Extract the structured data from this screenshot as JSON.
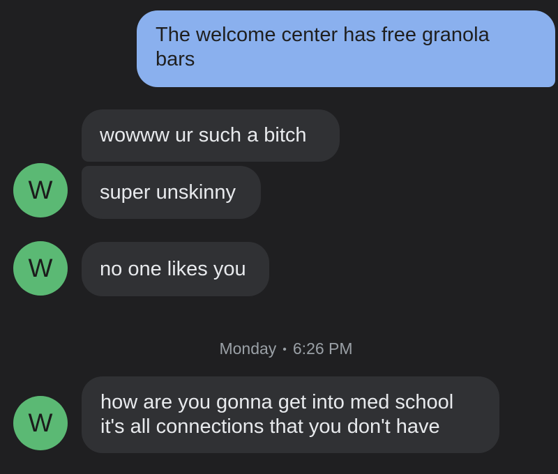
{
  "messages": [
    {
      "direction": "outgoing",
      "lines": [
        "The welcome center has free granola",
        "bars"
      ]
    },
    {
      "direction": "incoming",
      "lines": [
        "wowww ur such a bitch"
      ]
    },
    {
      "direction": "incoming",
      "avatar": "W",
      "lines": [
        "super unskinny"
      ]
    },
    {
      "direction": "incoming",
      "avatar": "W",
      "lines": [
        "no one likes you"
      ]
    },
    {
      "direction": "incoming",
      "avatar": "W",
      "lines": [
        "how are you gonna get into med school",
        "it's all connections that you don't have"
      ]
    }
  ],
  "timestamp": {
    "day": "Monday",
    "separator": "•",
    "time": "6:26 PM"
  },
  "colors": {
    "background": "#1f1f21",
    "outgoing_bubble": "#8ab0ee",
    "incoming_bubble": "#303134",
    "avatar": "#5bb974",
    "timestamp_text": "#9aa0a6"
  },
  "icons": {
    "avatar": "letter-avatar-circle"
  }
}
